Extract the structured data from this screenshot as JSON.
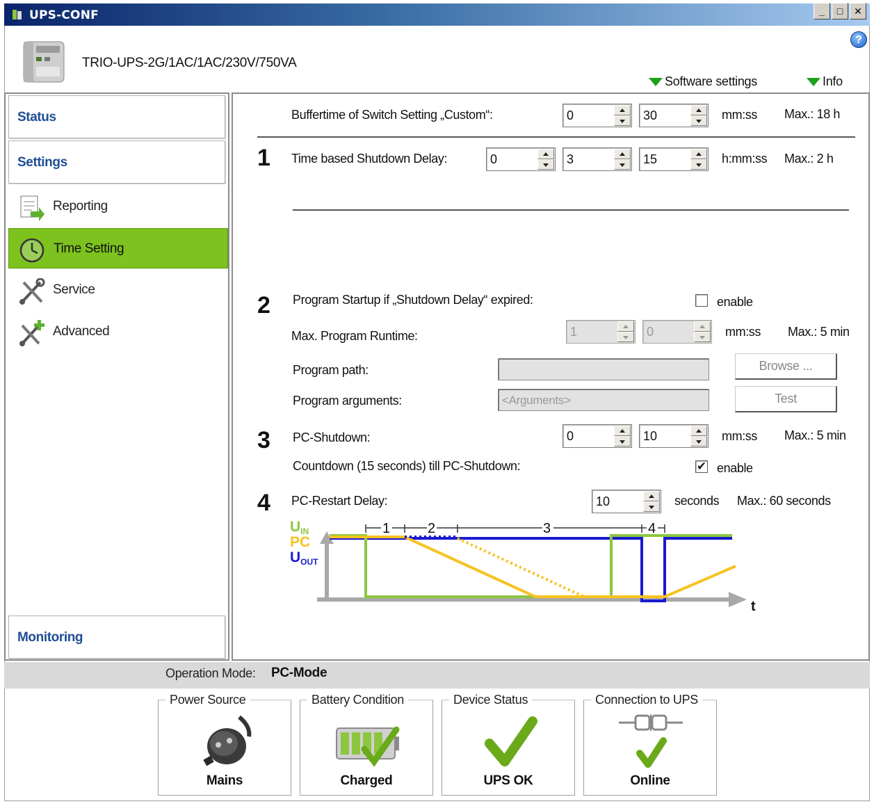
{
  "window": {
    "title": "UPS-CONF"
  },
  "header": {
    "device_name": "TRIO-UPS-2G/1AC/1AC/230V/750VA",
    "software_settings_label": "Software settings",
    "info_label": "Info",
    "help": "?"
  },
  "nav": {
    "status": "Status",
    "settings": "Settings",
    "items": [
      {
        "label": "Reporting",
        "icon": "report-icon"
      },
      {
        "label": "Time Setting",
        "icon": "clock-icon",
        "active": true
      },
      {
        "label": "Service",
        "icon": "tools-icon"
      },
      {
        "label": "Advanced",
        "icon": "tools-plus-icon"
      }
    ],
    "monitoring": "Monitoring"
  },
  "buffertime": {
    "label": "Buffertime of Switch Setting „Custom“:",
    "fields": [
      "0",
      "30"
    ],
    "unit": "mm:ss",
    "max": "Max.: 18 h"
  },
  "section1": {
    "num": "1",
    "label": "Time based Shutdown Delay:",
    "fields": [
      "0",
      "3",
      "15"
    ],
    "unit": "h:mm:ss",
    "max": "Max.: 2 h"
  },
  "section2": {
    "num": "2",
    "label": "Program Startup if „Shutdown Delay“ expired:",
    "enable_label": "enable",
    "enable_checked": false,
    "runtime_label": "Max. Program Runtime:",
    "runtime_fields": [
      "1",
      "0"
    ],
    "runtime_unit": "mm:ss",
    "runtime_max": "Max.: 5 min",
    "path_label": "Program path:",
    "browse_label": "Browse ...",
    "args_label": "Program arguments:",
    "args_placeholder": "<Arguments>",
    "test_label": "Test"
  },
  "section3": {
    "num": "3",
    "label": "PC-Shutdown:",
    "fields": [
      "0",
      "10"
    ],
    "unit": "mm:ss",
    "max": "Max.: 5 min",
    "countdown_label": "Countdown (15 seconds) till PC-Shutdown:",
    "enable_label": "enable",
    "enable_checked": true,
    "check_glyph": "✔"
  },
  "section4": {
    "num": "4",
    "label": "PC-Restart Delay:",
    "field": "10",
    "unit": "seconds",
    "max": "Max.: 60 seconds"
  },
  "diagram": {
    "uin_main": "U",
    "uin_sub": "IN",
    "pc_label": "PC",
    "uout_main": "U",
    "uout_sub": "OUT",
    "t_label": "t",
    "phases": [
      "1",
      "2",
      "3",
      "4"
    ],
    "colors": {
      "uin": "#8cc63f",
      "pc": "#f7c221",
      "uout": "#1a1acf",
      "axis": "#a8a8a8"
    }
  },
  "statusbar": {
    "operation_mode_label": "Operation Mode:",
    "operation_mode_value": "PC-Mode"
  },
  "status_groups": [
    {
      "title": "Power Source",
      "value": "Mains",
      "icon": "power-plug-icon"
    },
    {
      "title": "Battery Condition",
      "value": "Charged",
      "icon": "battery-check-icon"
    },
    {
      "title": "Device Status",
      "value": "UPS OK",
      "icon": "checkmark-icon"
    },
    {
      "title": "Connection to UPS",
      "value": "Online",
      "icon": "connection-check-icon"
    }
  ]
}
